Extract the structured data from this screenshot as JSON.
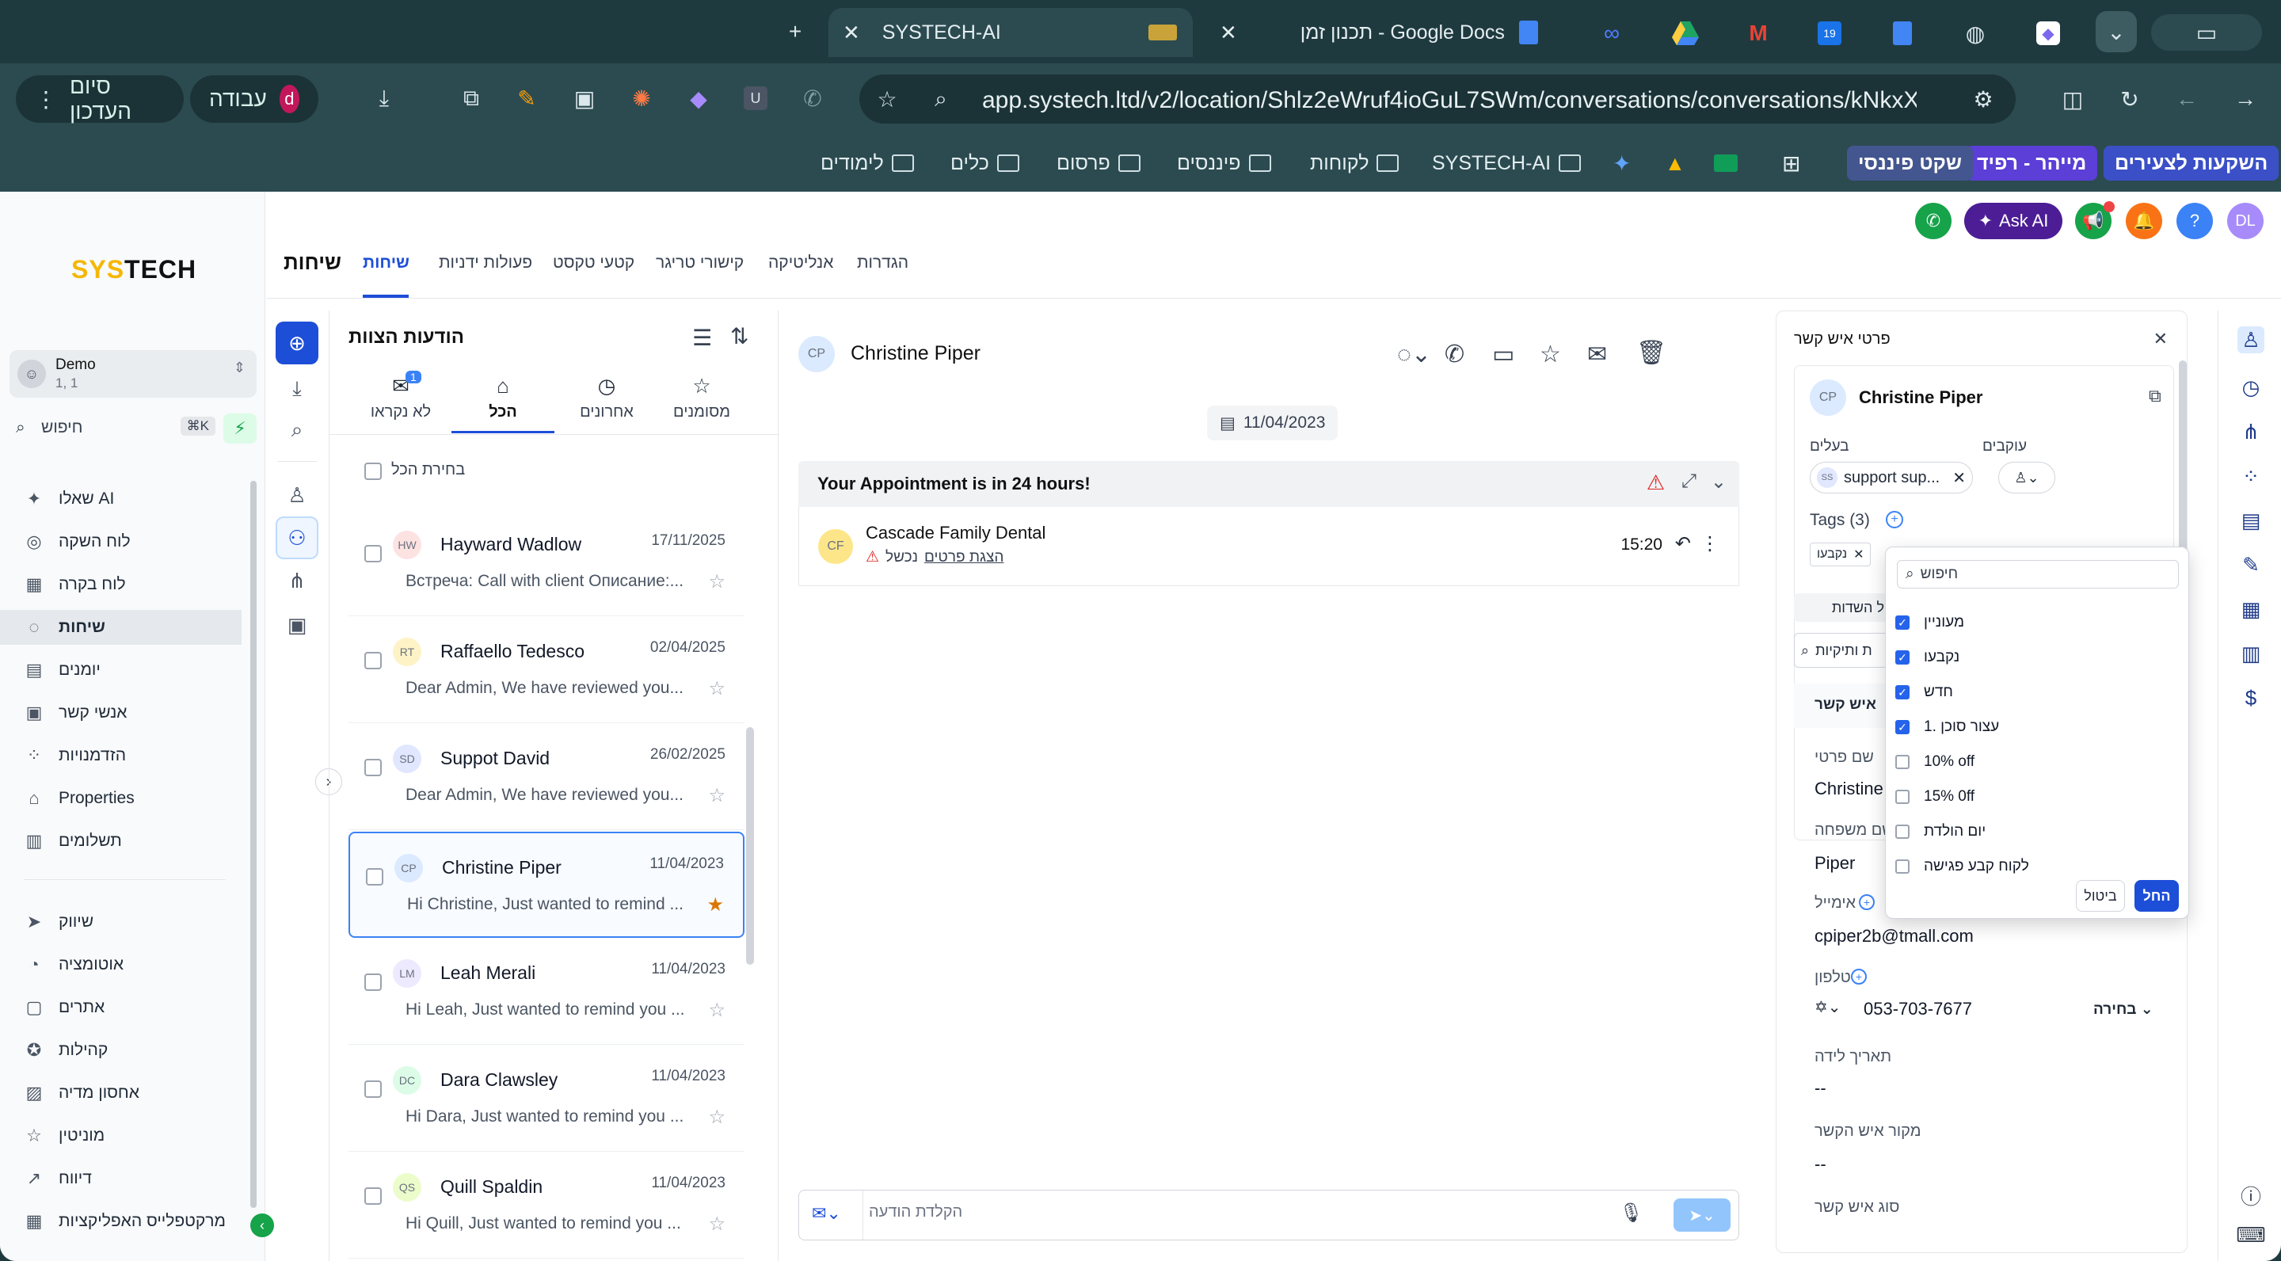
{
  "browser": {
    "tabs": [
      {
        "title": "SYSTECH-AI"
      },
      {
        "title": "תכנון זמן - Google Docs"
      }
    ],
    "url": "app.systech.ltd/v2/location/Shlz2eWruf4ioGuL7SWm/conversations/conversations/kNkxXs8L...",
    "profile_label": "עבודה",
    "profile_initial": "d",
    "update_label": "סיום העדכון",
    "bookmarks": [
      {
        "label": "השקעות לצעירים"
      },
      {
        "label": "מייהר - רפיד"
      },
      {
        "label": "שקט פיננסי"
      },
      {
        "label": "SYSTECH-AI"
      },
      {
        "label": "לקוחות"
      },
      {
        "label": "פיננסים"
      },
      {
        "label": "פרסום"
      },
      {
        "label": "כלים"
      },
      {
        "label": "לימודים"
      }
    ]
  },
  "sidebar": {
    "logo_prefix": "SYS",
    "logo_suffix": "TECH",
    "account_name": "Demo",
    "account_sub": "1, 1",
    "search_label": "חיפוש",
    "search_shortcut": "⌘K",
    "items": [
      {
        "label": "שאלו AI"
      },
      {
        "label": "לוח השקה"
      },
      {
        "label": "לוח בקרה"
      },
      {
        "label": "שיחות"
      },
      {
        "label": "יומנים"
      },
      {
        "label": "אנשי קשר"
      },
      {
        "label": "הזדמנויות"
      },
      {
        "label": "Properties"
      },
      {
        "label": "תשלומים"
      },
      {
        "label": "שיווק"
      },
      {
        "label": "אוטומציה"
      },
      {
        "label": "אתרים"
      },
      {
        "label": "קהילות"
      },
      {
        "label": "אחסון מדיה"
      },
      {
        "label": "מוניטין"
      },
      {
        "label": "דיווח"
      },
      {
        "label": "מרקטפלייס האפליקציות"
      }
    ]
  },
  "toptabs": {
    "title": "שיחות",
    "items": [
      {
        "label": "שיחות"
      },
      {
        "label": "פעולות ידניות"
      },
      {
        "label": "קטעי טקסט"
      },
      {
        "label": "קישורי טריגר"
      },
      {
        "label": "אנליטיקה"
      },
      {
        "label": "הגדרות"
      }
    ],
    "ask_ai": "Ask AI",
    "user_initials": "DL"
  },
  "convlist": {
    "title": "הודעות הצוות",
    "filters": [
      {
        "label": "מסומנים"
      },
      {
        "label": "אחרונים"
      },
      {
        "label": "הכל"
      },
      {
        "label": "לא נקראו",
        "badge": "1"
      }
    ],
    "select_all": "בחירת הכל",
    "items": [
      {
        "initials": "HW",
        "name": "Hayward Wadlow",
        "date": "17/11/2025",
        "preview": "Встреча: Call with client Описание:..."
      },
      {
        "initials": "RT",
        "name": "Raffaello Tedesco",
        "date": "02/04/2025",
        "preview": "Dear Admin, We have reviewed you..."
      },
      {
        "initials": "SD",
        "name": "Suppot David",
        "date": "26/02/2025",
        "preview": "Dear Admin, We have reviewed you..."
      },
      {
        "initials": "CP",
        "name": "Christine Piper",
        "date": "11/04/2023",
        "preview": "Hi Christine, Just wanted to remind ..."
      },
      {
        "initials": "LM",
        "name": "Leah Merali",
        "date": "11/04/2023",
        "preview": "Hi Leah, Just wanted to remind you ..."
      },
      {
        "initials": "DC",
        "name": "Dara Clawsley",
        "date": "11/04/2023",
        "preview": "Hi Dara, Just wanted to remind you ..."
      },
      {
        "initials": "QS",
        "name": "Quill Spaldin",
        "date": "11/04/2023",
        "preview": "Hi Quill, Just wanted to remind you ..."
      }
    ]
  },
  "chat": {
    "contact_initials": "CP",
    "contact_name": "Christine Piper",
    "date": "11/04/2023",
    "banner": "Your Appointment is in 24 hours!",
    "message_initials": "CF",
    "message_sender": "Cascade Family Dental",
    "message_status": "נכשל",
    "message_link": "הצגת פרטים",
    "message_time": "15:20",
    "input_placeholder": "הקלדת הודעה"
  },
  "details": {
    "title": "פרטי איש קשר",
    "contact_initials": "CP",
    "contact_name": "Christine Piper",
    "owners_label": "בעלים",
    "owner_initials": "SS",
    "owner_value": "support sup...",
    "followers_label": "עוקבים",
    "tags_label": "Tags (3)",
    "tag_chip": "נקבעו",
    "all_fields": "ל השדות",
    "search_fields": "ת ותיקיות",
    "section": "איש קשר",
    "first_name_label": "שם פרטי",
    "first_name": "Christine",
    "last_name_label": "שם משפחה",
    "last_name": "Piper",
    "email_label": "אימייל",
    "email": "cpiper2b@tmall.com",
    "phone_label": "טלפון",
    "phone": "053-703-7677",
    "phone_type": "בחירה",
    "birthday_label": "תאריך לידה",
    "birthday": "--",
    "source_label": "מקור איש הקשר",
    "source": "--",
    "type_label": "סוג איש קשר"
  },
  "tagdropdown": {
    "search_placeholder": "חיפוש",
    "options": [
      {
        "label": "מעוניין",
        "checked": true
      },
      {
        "label": "נקבעו",
        "checked": true
      },
      {
        "label": "חדש",
        "checked": true
      },
      {
        "label": "1. עצור סוכן",
        "checked": true
      },
      {
        "label": "10% off",
        "checked": false
      },
      {
        "label": "15% 0ff",
        "checked": false
      },
      {
        "label": "יום הולדת",
        "checked": false
      },
      {
        "label": "לקוח קבע פגישה",
        "checked": false
      }
    ],
    "cancel": "ביטול",
    "apply": "החל"
  }
}
